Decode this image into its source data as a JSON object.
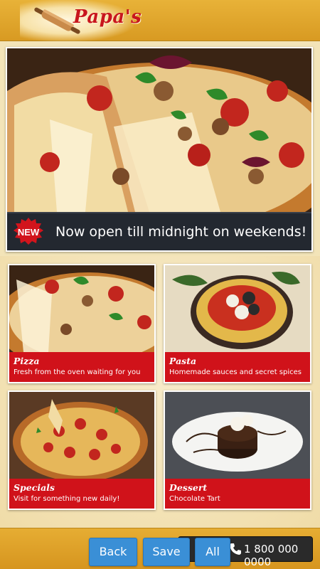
{
  "header": {
    "brand": "Papa's",
    "logo_icon": "rolling-pin-icon"
  },
  "hero": {
    "badge": "NEW",
    "message": "Now open till midnight on weekends!"
  },
  "menu": [
    {
      "title": "Pizza",
      "subtitle": "Fresh from the oven waiting for you"
    },
    {
      "title": "Pasta",
      "subtitle": "Homemade sauces and secret spices"
    },
    {
      "title": "Specials",
      "subtitle": "Visit for something new daily!"
    },
    {
      "title": "Dessert",
      "subtitle": "Chocolate Tart"
    }
  ],
  "footer": {
    "phone": "1 800 000 0000",
    "buttons": {
      "back": "Back",
      "save": "Save",
      "all": "All"
    }
  },
  "colors": {
    "header": "#e1a62e",
    "brand_red": "#c8161d",
    "caption_red": "#d0121a",
    "banner_dark": "#232830",
    "button_blue": "#3a8fd6"
  }
}
